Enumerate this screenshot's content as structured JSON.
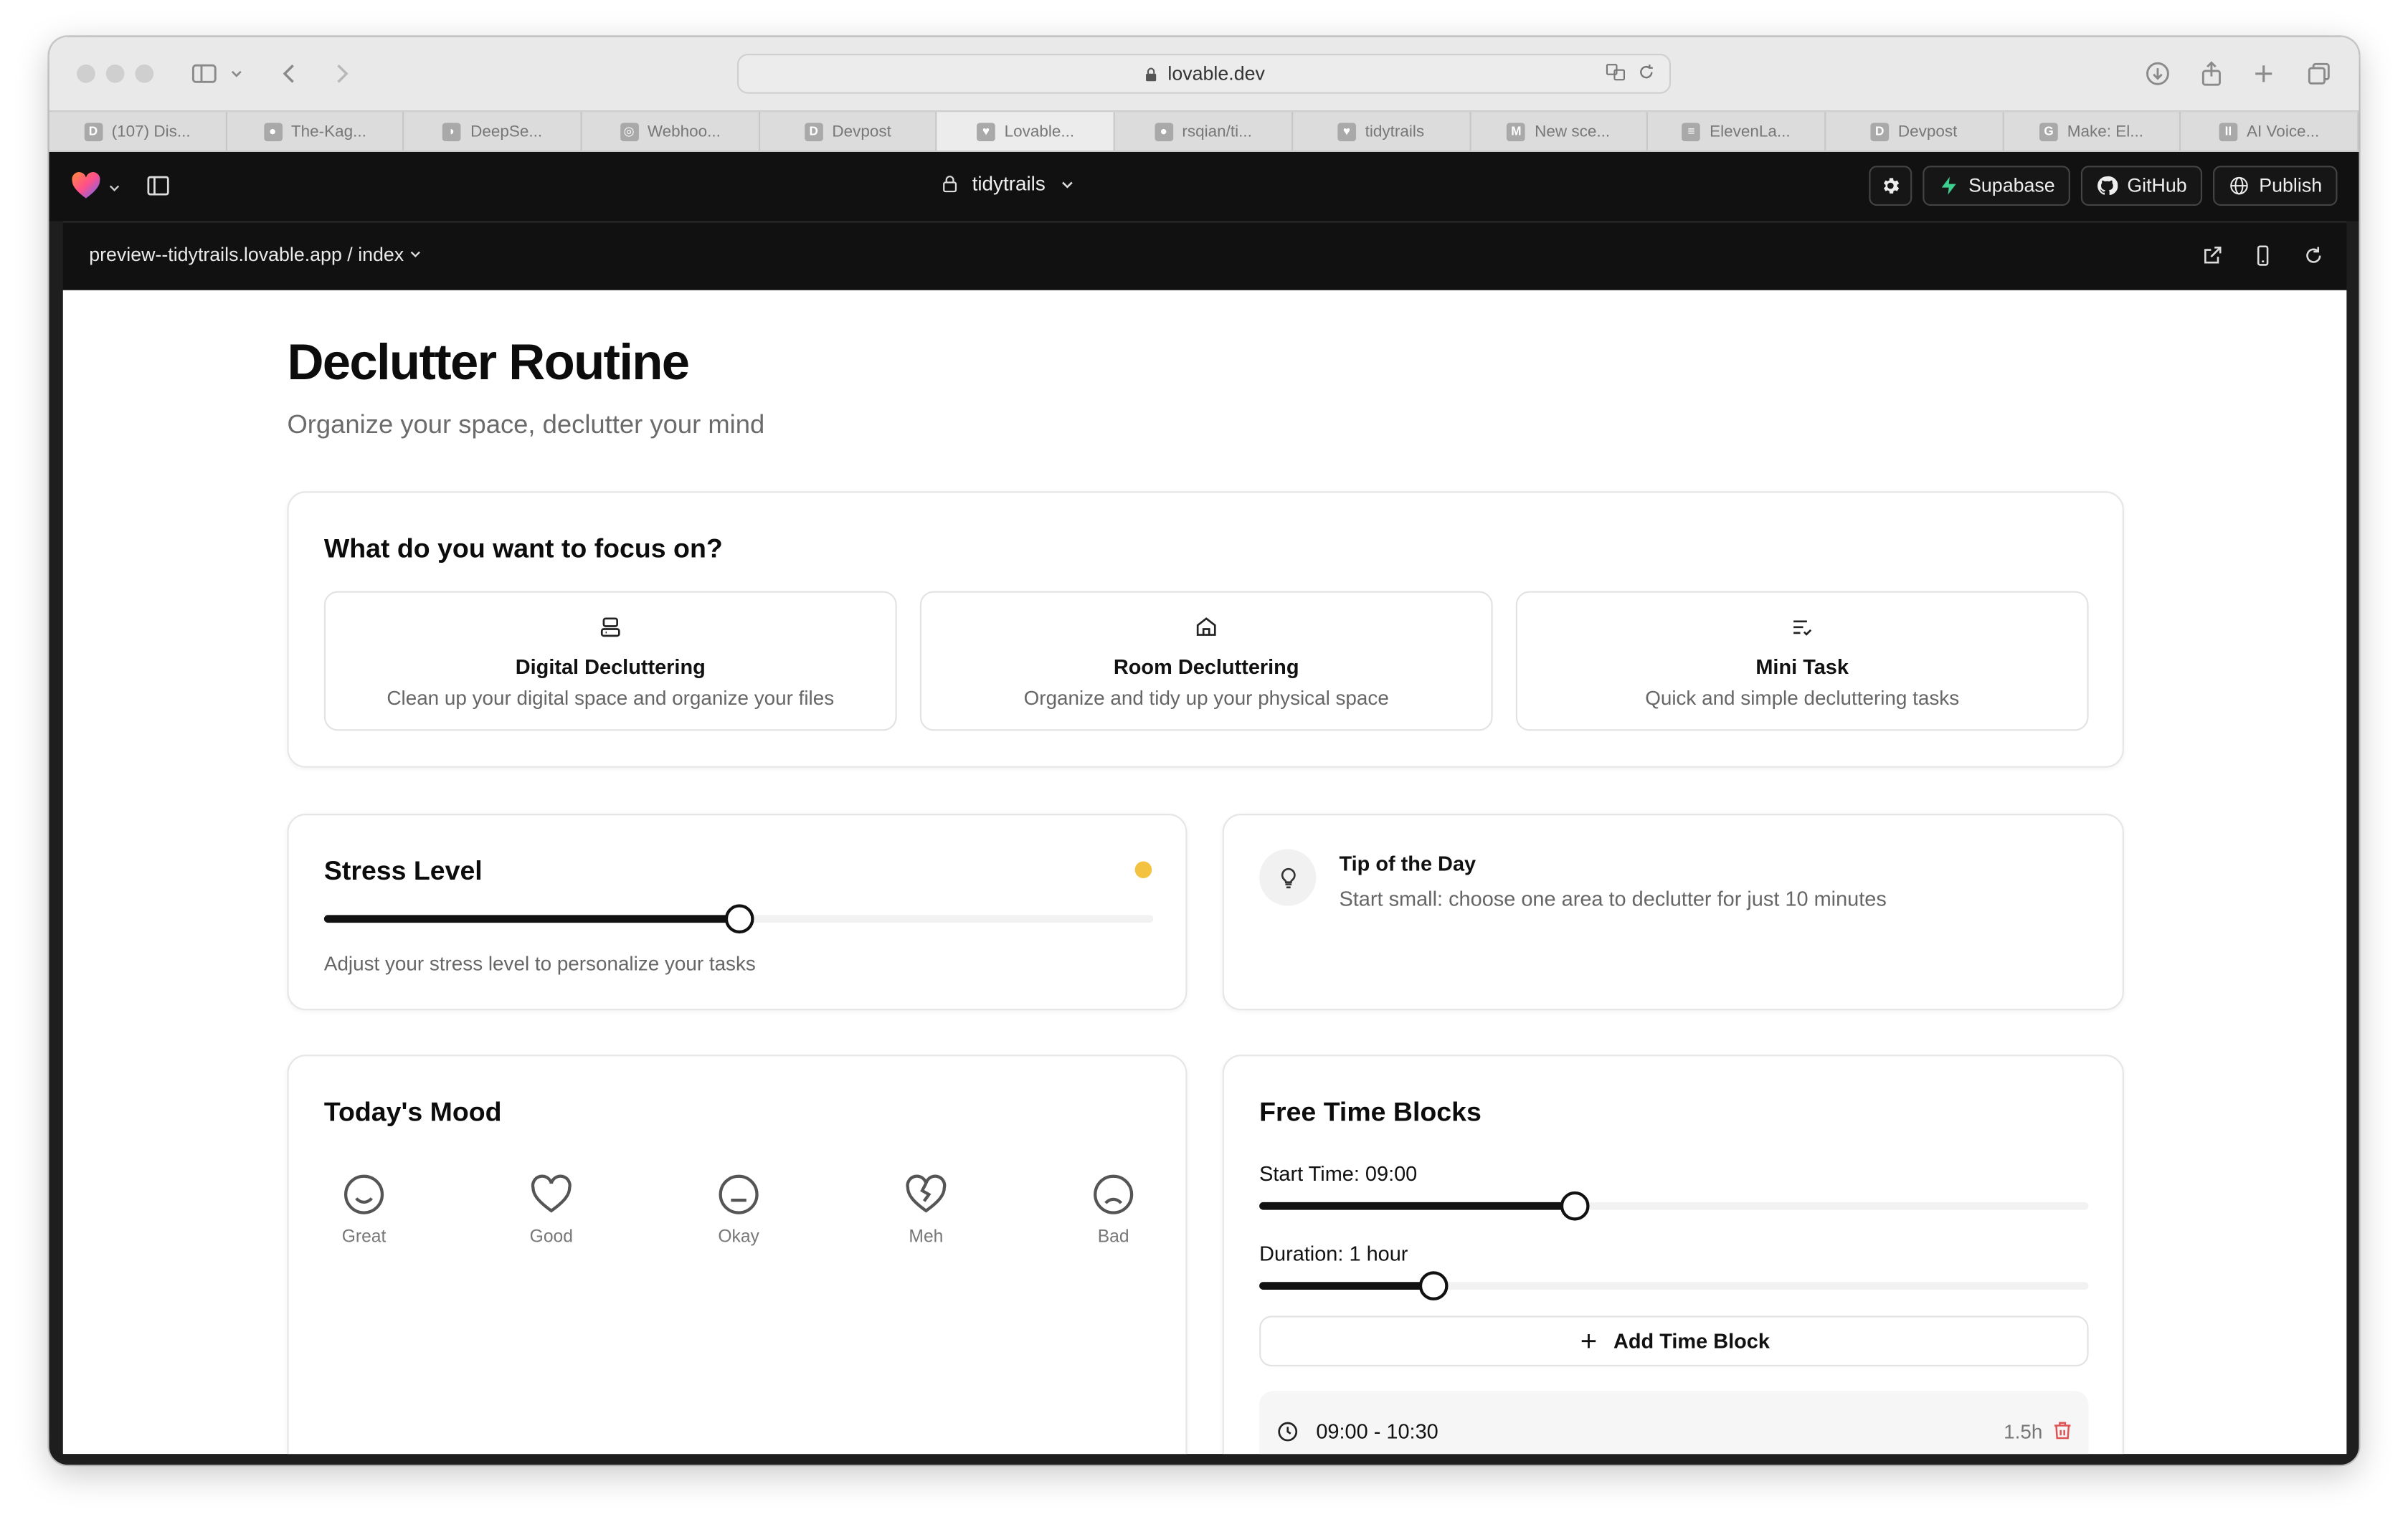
{
  "browser": {
    "url": "lovable.dev",
    "tabs": [
      {
        "label": "(107) Dis...",
        "fav": "D"
      },
      {
        "label": "The-Kag...",
        "fav": "github"
      },
      {
        "label": "DeepSe...",
        "fav": "whale"
      },
      {
        "label": "Webhoo...",
        "fav": "hook"
      },
      {
        "label": "Devpost",
        "fav": "D"
      },
      {
        "label": "Lovable...",
        "fav": "heart",
        "active": true
      },
      {
        "label": "rsqian/ti...",
        "fav": "github"
      },
      {
        "label": "tidytrails",
        "fav": "heart"
      },
      {
        "label": "New sce...",
        "fav": "M"
      },
      {
        "label": "ElevenLa...",
        "fav": "doc"
      },
      {
        "label": "Devpost",
        "fav": "D"
      },
      {
        "label": "Make: El...",
        "fav": "G"
      },
      {
        "label": "AI Voice...",
        "fav": "II"
      }
    ]
  },
  "lovable": {
    "project": "tidytrails",
    "buttons": {
      "supabase": "Supabase",
      "github": "GitHub",
      "publish": "Publish"
    },
    "preview_path": "preview--tidytrails.lovable.app",
    "page_select": "index"
  },
  "page": {
    "title": "Declutter Routine",
    "subtitle": "Organize your space, declutter your mind"
  },
  "focus": {
    "heading": "What do you want to focus on?",
    "options": [
      {
        "title": "Digital Decluttering",
        "desc": "Clean up your digital space and organize your files",
        "icon": "monitor-icon"
      },
      {
        "title": "Room Decluttering",
        "desc": "Organize and tidy up your physical space",
        "icon": "home-icon"
      },
      {
        "title": "Mini Task",
        "desc": "Quick and simple decluttering tasks",
        "icon": "list-check-icon"
      }
    ]
  },
  "stress": {
    "heading": "Stress Level",
    "value_fraction": 0.5,
    "helper": "Adjust your stress level to personalize your tasks",
    "indicator_color": "#f3c240"
  },
  "tip": {
    "title": "Tip of the Day",
    "text": "Start small: choose one area to declutter for just 10 minutes"
  },
  "mood": {
    "heading": "Today's Mood",
    "items": [
      {
        "label": "Great",
        "icon": "smile-icon"
      },
      {
        "label": "Good",
        "icon": "heart-icon"
      },
      {
        "label": "Okay",
        "icon": "meh-icon"
      },
      {
        "label": "Meh",
        "icon": "heart-crack-icon"
      },
      {
        "label": "Bad",
        "icon": "frown-icon"
      }
    ]
  },
  "free_time": {
    "heading": "Free Time Blocks",
    "start_label": "Start Time: 09:00",
    "start_fraction": 0.38,
    "duration_label": "Duration: 1 hour",
    "duration_fraction": 0.21,
    "add_button": "Add Time Block",
    "blocks": [
      {
        "range": "09:00 - 10:30",
        "duration": "1.5h"
      }
    ]
  }
}
